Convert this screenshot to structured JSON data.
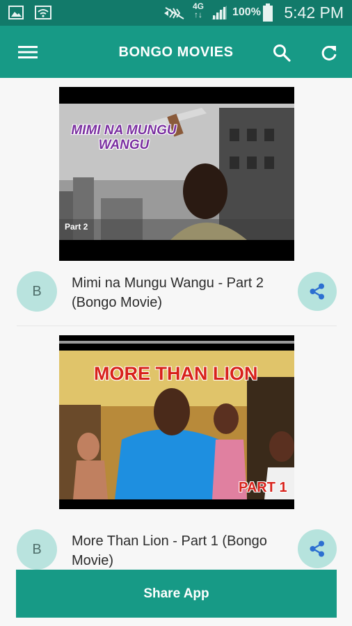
{
  "status_bar": {
    "battery_percent": "100%",
    "network": "4G",
    "time": "5:42 PM"
  },
  "app_bar": {
    "title": "BONGO MOVIES",
    "menu_icon": "hamburger-menu-icon",
    "search_icon": "search-icon",
    "refresh_icon": "refresh-icon"
  },
  "videos": [
    {
      "thumbnail_title": "MIMI NA MUNGU WANGU",
      "thumbnail_part": "Part 2",
      "avatar_letter": "B",
      "title": "Mimi na Mungu Wangu - Part 2 (Bongo Movie)"
    },
    {
      "thumbnail_title": "MORE THAN LION",
      "thumbnail_part": "PART 1",
      "avatar_letter": "B",
      "title": "More Than Lion - Part 1 (Bongo Movie)"
    }
  ],
  "share_app_label": "Share App",
  "colors": {
    "status_bar": "#127a6a",
    "app_bar": "#179a86",
    "avatar_bg": "#b9e3de",
    "share_icon": "#2c6fd1"
  }
}
